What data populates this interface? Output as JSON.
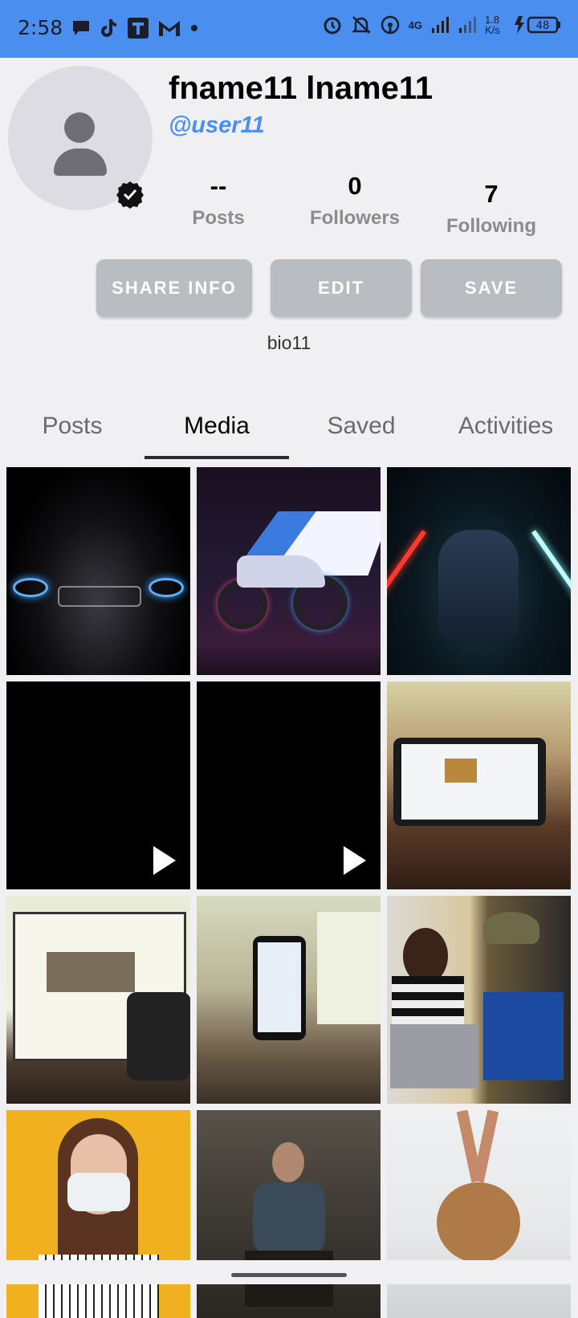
{
  "status_bar": {
    "time": "2:58",
    "network_speed": "1.8 K/s",
    "network_type": "4G",
    "battery": "48",
    "left_icons": [
      "chat-bubble-icon",
      "tiktok-icon",
      "t-app-icon",
      "gmail-icon",
      "dot-icon"
    ],
    "right_icons": [
      "alarm-icon",
      "bell-off-icon",
      "hotspot-icon",
      "signal-icon",
      "signal-icon",
      "battery-charging-icon"
    ]
  },
  "profile": {
    "name": "fname11 lname11",
    "handle": "@user11",
    "bio": "bio11",
    "verified_icon": "verified-badge-icon",
    "avatar_icon": "person-icon"
  },
  "stats": [
    {
      "value": "--",
      "label": "Posts"
    },
    {
      "value": "0",
      "label": "Followers"
    },
    {
      "value": "7",
      "label": "Following"
    }
  ],
  "buttons": {
    "share": "SHARE INFO",
    "edit": "EDIT",
    "save": "SAVE"
  },
  "tabs": [
    {
      "label": "Posts",
      "active": false
    },
    {
      "label": "Media",
      "active": true
    },
    {
      "label": "Saved",
      "active": false
    },
    {
      "label": "Activities",
      "active": false
    }
  ],
  "media": [
    {
      "kind": "image",
      "subject": "dark car front with blue headlights"
    },
    {
      "kind": "image",
      "subject": "motorcycle with M logo"
    },
    {
      "kind": "image",
      "subject": "car with red and teal lights"
    },
    {
      "kind": "video",
      "subject": "black video"
    },
    {
      "kind": "video",
      "subject": "black video"
    },
    {
      "kind": "image",
      "subject": "tablet on desk"
    },
    {
      "kind": "image",
      "subject": "monitor and phones"
    },
    {
      "kind": "image",
      "subject": "phone on desk"
    },
    {
      "kind": "image",
      "subject": "two women with laptops"
    },
    {
      "kind": "image",
      "subject": "woman with face mask"
    },
    {
      "kind": "image",
      "subject": "man sitting outdoors"
    },
    {
      "kind": "image",
      "subject": "woman with straw hat"
    }
  ],
  "colors": {
    "status_bar": "#4a8ef0",
    "accent": "#4a8ef0",
    "button": "#b9bcc1",
    "background": "#f0f0f3"
  }
}
